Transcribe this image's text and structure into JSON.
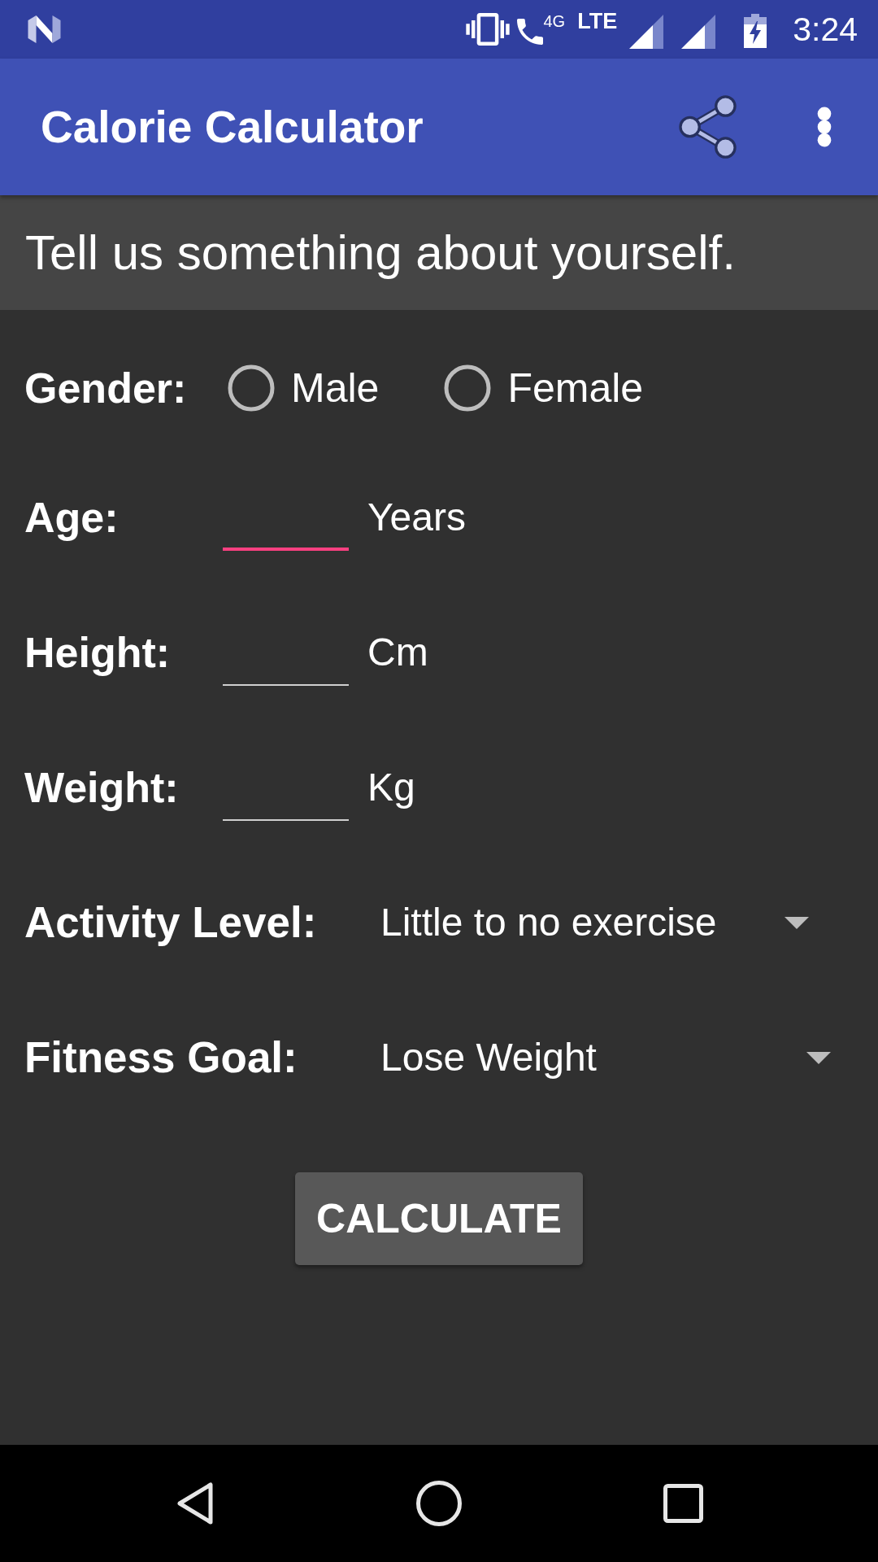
{
  "status_bar": {
    "network_generation": "4G",
    "network_type": "LTE",
    "time": "3:24"
  },
  "app_bar": {
    "title": "Calorie Calculator"
  },
  "intro": {
    "text": "Tell us something about yourself."
  },
  "form": {
    "gender": {
      "label": "Gender:",
      "options": [
        {
          "label": "Male",
          "selected": false
        },
        {
          "label": "Female",
          "selected": false
        }
      ]
    },
    "fields": [
      {
        "label": "Age:",
        "unit": "Years",
        "focused": true
      },
      {
        "label": "Height:",
        "unit": "Cm",
        "focused": false
      },
      {
        "label": "Weight:",
        "unit": "Kg",
        "focused": false
      }
    ],
    "dropdowns": [
      {
        "label": "Activity Level:",
        "value": "Little to no exercise"
      },
      {
        "label": "Fitness Goal:",
        "value": "Lose Weight"
      }
    ],
    "calculate_button": {
      "label": "CALCULATE"
    }
  }
}
